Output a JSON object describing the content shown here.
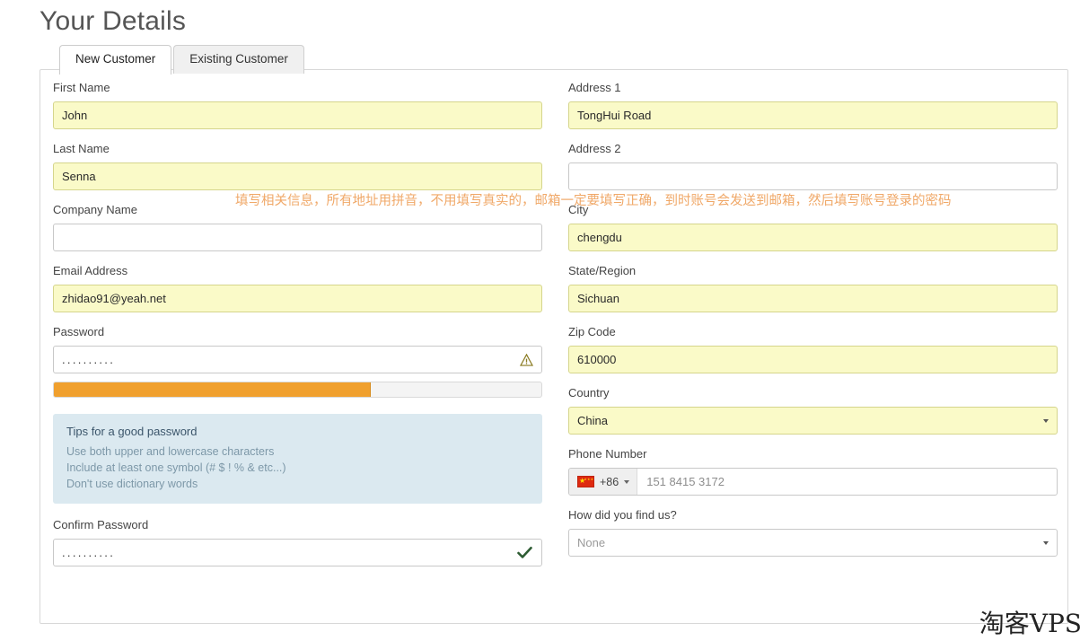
{
  "page_title": "Your Details",
  "tabs": [
    {
      "label": "New Customer",
      "active": true
    },
    {
      "label": "Existing Customer",
      "active": false
    }
  ],
  "left_column": {
    "first_name": {
      "label": "First Name",
      "value": "John",
      "filled": true
    },
    "last_name": {
      "label": "Last Name",
      "value": "Senna",
      "filled": true
    },
    "company_name": {
      "label": "Company Name",
      "value": "",
      "filled": false
    },
    "email": {
      "label": "Email Address",
      "value": "zhidao91@yeah.net",
      "filled": true
    },
    "password": {
      "label": "Password",
      "value": "..........",
      "filled": false,
      "status_icon": "warning-triangle-icon"
    },
    "password_strength": {
      "percent": 65,
      "color": "#f0a02e"
    },
    "tips": {
      "heading": "Tips for a good password",
      "lines": [
        "Use both upper and lowercase characters",
        "Include at least one symbol (# $ ! % & etc...)",
        "Don't use dictionary words"
      ]
    },
    "confirm_password": {
      "label": "Confirm Password",
      "value": "..........",
      "filled": false,
      "status_icon": "check-mark-icon"
    }
  },
  "right_column": {
    "address1": {
      "label": "Address 1",
      "value": "TongHui Road",
      "filled": true
    },
    "address2": {
      "label": "Address 2",
      "value": "",
      "filled": false
    },
    "city": {
      "label": "City",
      "value": "chengdu",
      "filled": true
    },
    "state": {
      "label": "State/Region",
      "value": "Sichuan",
      "filled": true
    },
    "zip": {
      "label": "Zip Code",
      "value": "610000",
      "filled": true
    },
    "country": {
      "label": "Country",
      "value": "China",
      "filled": true
    },
    "phone": {
      "label": "Phone Number",
      "dial_code": "+86",
      "value": "151 8415 3172",
      "flag": "china-flag-icon"
    },
    "referral": {
      "label": "How did you find us?",
      "value": "None",
      "filled": false
    }
  },
  "annotation": "填写相关信息，所有地址用拼音，不用填写真实的，邮箱一定要填写正确，到时账号会发送到邮箱，然后填写账号登录的密码",
  "watermark": "淘客VPS",
  "colors": {
    "autofill_yellow": "#fafac8",
    "strength_orange": "#f0a02e",
    "tips_blue": "#dbe9f0",
    "annotation_orange": "#f0a868",
    "flag_red": "#de2910"
  }
}
